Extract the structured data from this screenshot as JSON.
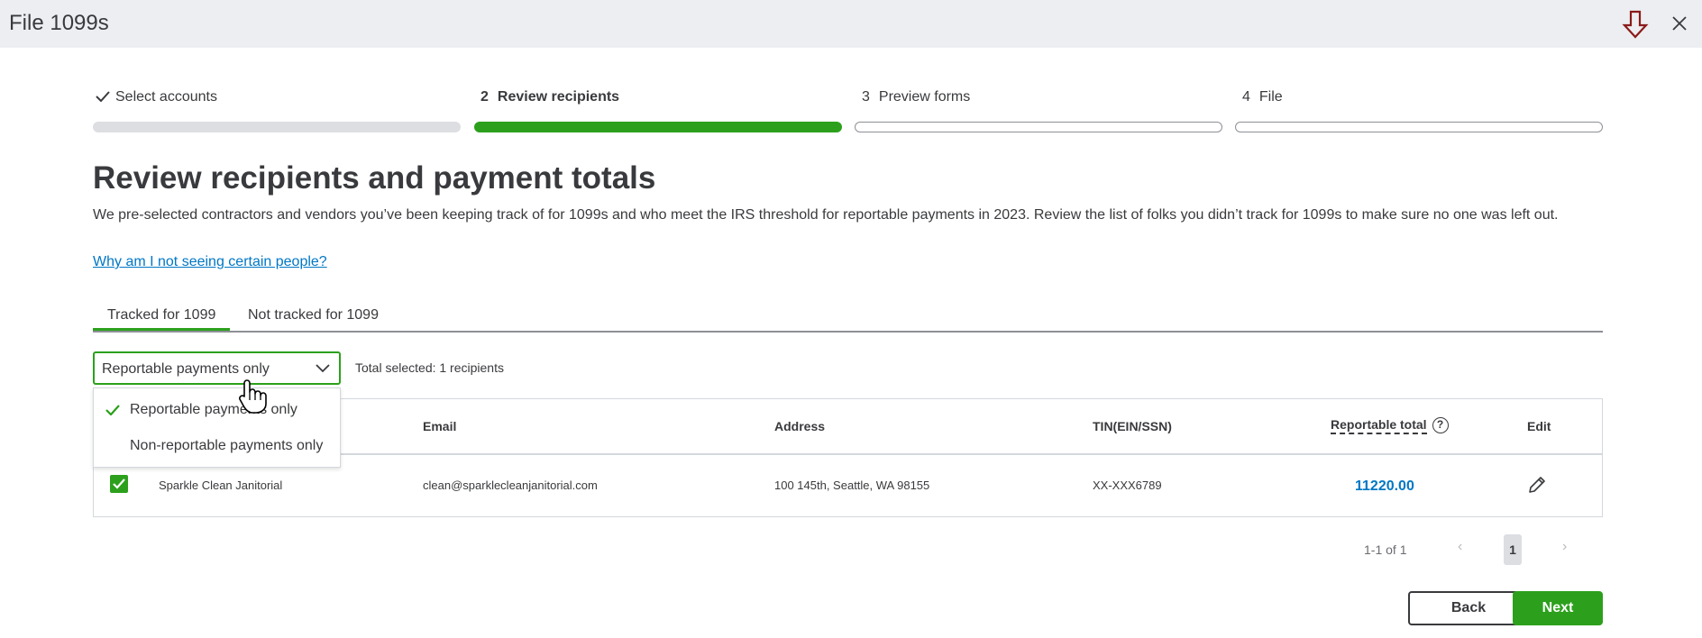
{
  "window": {
    "title": "File 1099s",
    "download_icon": "download-arrow-icon",
    "close_icon": "close-icon"
  },
  "stepper": {
    "steps": [
      {
        "num": "",
        "label": "Select accounts",
        "state": "done"
      },
      {
        "num": "2",
        "label": "Review recipients",
        "state": "active"
      },
      {
        "num": "3",
        "label": "Preview forms",
        "state": "todo"
      },
      {
        "num": "4",
        "label": "File",
        "state": "todo"
      }
    ]
  },
  "page": {
    "heading": "Review recipients and payment totals",
    "description": "We pre-selected contractors and vendors you’ve been keeping track of for 1099s and who meet the IRS threshold for reportable payments in 2023. Review the list of folks you didn’t track for 1099s to make sure no one was left out.",
    "help_link": "Why am I not seeing certain people?"
  },
  "tabs": [
    {
      "label": "Tracked for 1099",
      "active": true
    },
    {
      "label": "Not tracked for 1099",
      "active": false
    }
  ],
  "filter": {
    "selected": "Reportable payments only",
    "options": [
      "Reportable payments only",
      "Non-reportable payments only"
    ],
    "total_selected": "Total selected: 1 recipients"
  },
  "table": {
    "headers": {
      "email": "Email",
      "address": "Address",
      "tin": "TIN(EIN/SSN)",
      "reportable_total": "Reportable total",
      "help": "?",
      "edit": "Edit"
    },
    "rows": [
      {
        "checked": true,
        "name": "Sparkle Clean Janitorial",
        "email": "clean@sparklecleanjanitorial.com",
        "address": "100 145th, Seattle, WA 98155",
        "tin": "XX-XXX6789",
        "reportable_total": "11220.00"
      }
    ]
  },
  "pagination": {
    "range": "1-1 of 1",
    "prev": "‹",
    "page": "1",
    "next": "›"
  },
  "footer": {
    "back_label": "Back",
    "next_label": "Next"
  },
  "colors": {
    "accent": "#2ca01c",
    "link": "#0077c5",
    "text": "#393a3d",
    "download_icon": "#8b1a1a"
  }
}
